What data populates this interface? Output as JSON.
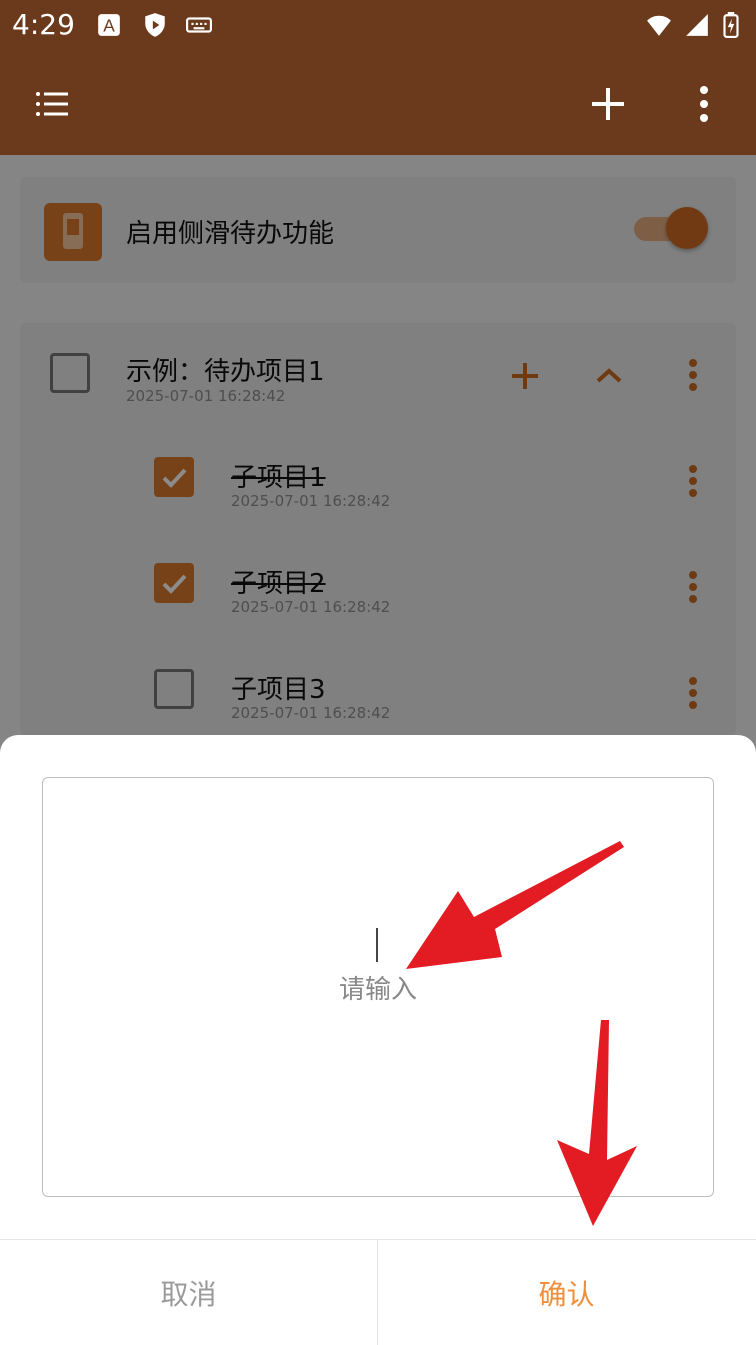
{
  "status_bar": {
    "time": "4:29"
  },
  "settings_card": {
    "label": "启用侧滑待办功能"
  },
  "todo": {
    "title": "示例：待办项目1",
    "date": "2025-07-01 16:28:42",
    "subitems": [
      {
        "label": "子项目1",
        "date": "2025-07-01 16:28:42",
        "checked": true
      },
      {
        "label": "子项目2",
        "date": "2025-07-01 16:28:42",
        "checked": true
      },
      {
        "label": "子项目3",
        "date": "2025-07-01 16:28:42",
        "checked": false
      }
    ]
  },
  "dialog": {
    "placeholder": "请输入",
    "cancel_label": "取消",
    "confirm_label": "确认"
  },
  "colors": {
    "brand_dark": "#6b3a1c",
    "accent": "#d9792b",
    "confirm_text": "#ef8f3a",
    "annotation_arrow": "#e31b23"
  }
}
